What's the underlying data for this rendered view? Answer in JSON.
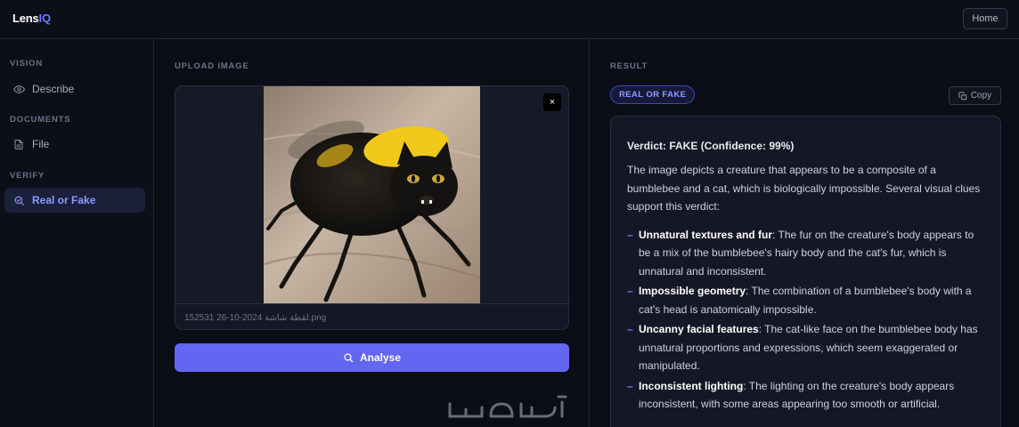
{
  "brand": {
    "name_prefix": "Lens",
    "name_suffix": "IQ"
  },
  "header": {
    "home_label": "Home"
  },
  "sidebar": {
    "sections": [
      {
        "heading": "VISION",
        "items": [
          {
            "label": "Describe",
            "icon": "eye-icon"
          }
        ]
      },
      {
        "heading": "DOCUMENTS",
        "items": [
          {
            "label": "File",
            "icon": "file-icon"
          }
        ]
      },
      {
        "heading": "VERIFY",
        "items": [
          {
            "label": "Real or Fake",
            "icon": "zoom-check-icon",
            "active": true
          }
        ]
      }
    ]
  },
  "upload": {
    "heading": "UPLOAD IMAGE",
    "close_label": "×",
    "file_name": "لقطة شاشة 2024-10-26 152531.png",
    "analyse_label": "Analyse",
    "watermark": "خمسات"
  },
  "result": {
    "heading": "RESULT",
    "badge": "REAL OR FAKE",
    "copy_label": "Copy",
    "verdict": "Verdict: FAKE (Confidence: 99%)",
    "summary": "The image depicts a creature that appears to be a composite of a bumblebee and a cat, which is biologically impossible. Several visual clues support this verdict:",
    "clues": [
      {
        "term": "Unnatural textures and fur",
        "text": ": The fur on the creature's body appears to be a mix of the bumblebee's hairy body and the cat's fur, which is unnatural and inconsistent."
      },
      {
        "term": "Impossible geometry",
        "text": ": The combination of a bumblebee's body with a cat's head is anatomically impossible."
      },
      {
        "term": "Uncanny facial features",
        "text": ": The cat-like face on the bumblebee body has unnatural proportions and expressions, which seem exaggerated or manipulated."
      },
      {
        "term": "Inconsistent lighting",
        "text": ": The lighting on the creature's body appears inconsistent, with some areas appearing too smooth or artificial."
      }
    ]
  },
  "colors": {
    "accent": "#6366f1",
    "accent_text": "#8f9cff",
    "background": "#0b0d17"
  }
}
